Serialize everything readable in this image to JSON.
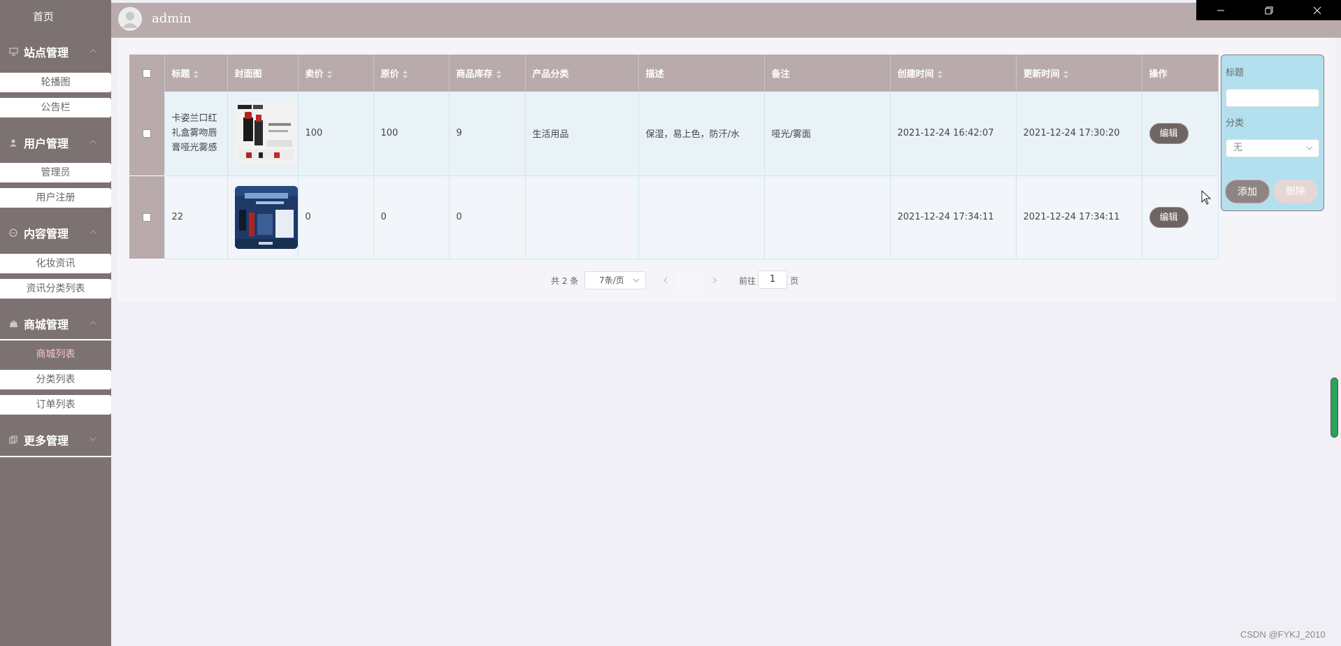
{
  "sidebar": {
    "home": "首页",
    "groups": [
      {
        "title": "站点管理",
        "icon": "monitor-icon",
        "items": [
          "轮播图",
          "公告栏"
        ]
      },
      {
        "title": "用户管理",
        "icon": "user-icon",
        "items": [
          "管理员",
          "用户注册"
        ]
      },
      {
        "title": "内容管理",
        "icon": "chat-icon",
        "items": [
          "化妆资讯",
          "资讯分类列表"
        ]
      },
      {
        "title": "商城管理",
        "icon": "shop-icon",
        "items": [
          "商城列表",
          "分类列表",
          "订单列表"
        ]
      },
      {
        "title": "更多管理",
        "icon": "copy-icon",
        "items": []
      }
    ],
    "active_item": "商城列表"
  },
  "header": {
    "username": "admin"
  },
  "table": {
    "columns": [
      "标题",
      "封面图",
      "卖价",
      "原价",
      "商品库存",
      "产品分类",
      "描述",
      "备注",
      "创建时间",
      "更新时间",
      "操作"
    ],
    "rows": [
      {
        "title": "卡姿兰口红礼盒雾吻唇膏哑光雾感",
        "price": "100",
        "original_price": "100",
        "stock": "9",
        "category": "生活用品",
        "description": "保湿，易上色，防汗/水",
        "remark": "哑光/雾面",
        "created": "2021-12-24 16:42:07",
        "updated": "2021-12-24 17:30:20",
        "action": "编辑"
      },
      {
        "title": "22",
        "price": "0",
        "original_price": "0",
        "stock": "0",
        "category": "",
        "description": "",
        "remark": "",
        "created": "2021-12-24 17:34:11",
        "updated": "2021-12-24 17:34:11",
        "action": "编辑"
      }
    ]
  },
  "pagination": {
    "total": "共 2 条",
    "page_size": "7条/页",
    "goto": "前往",
    "page": "1",
    "unit": "页"
  },
  "side_form": {
    "title_label": "标题",
    "category_label": "分类",
    "category_value": "无",
    "add": "添加",
    "delete": "删除"
  },
  "watermark": "CSDN @FYKJ_2010"
}
